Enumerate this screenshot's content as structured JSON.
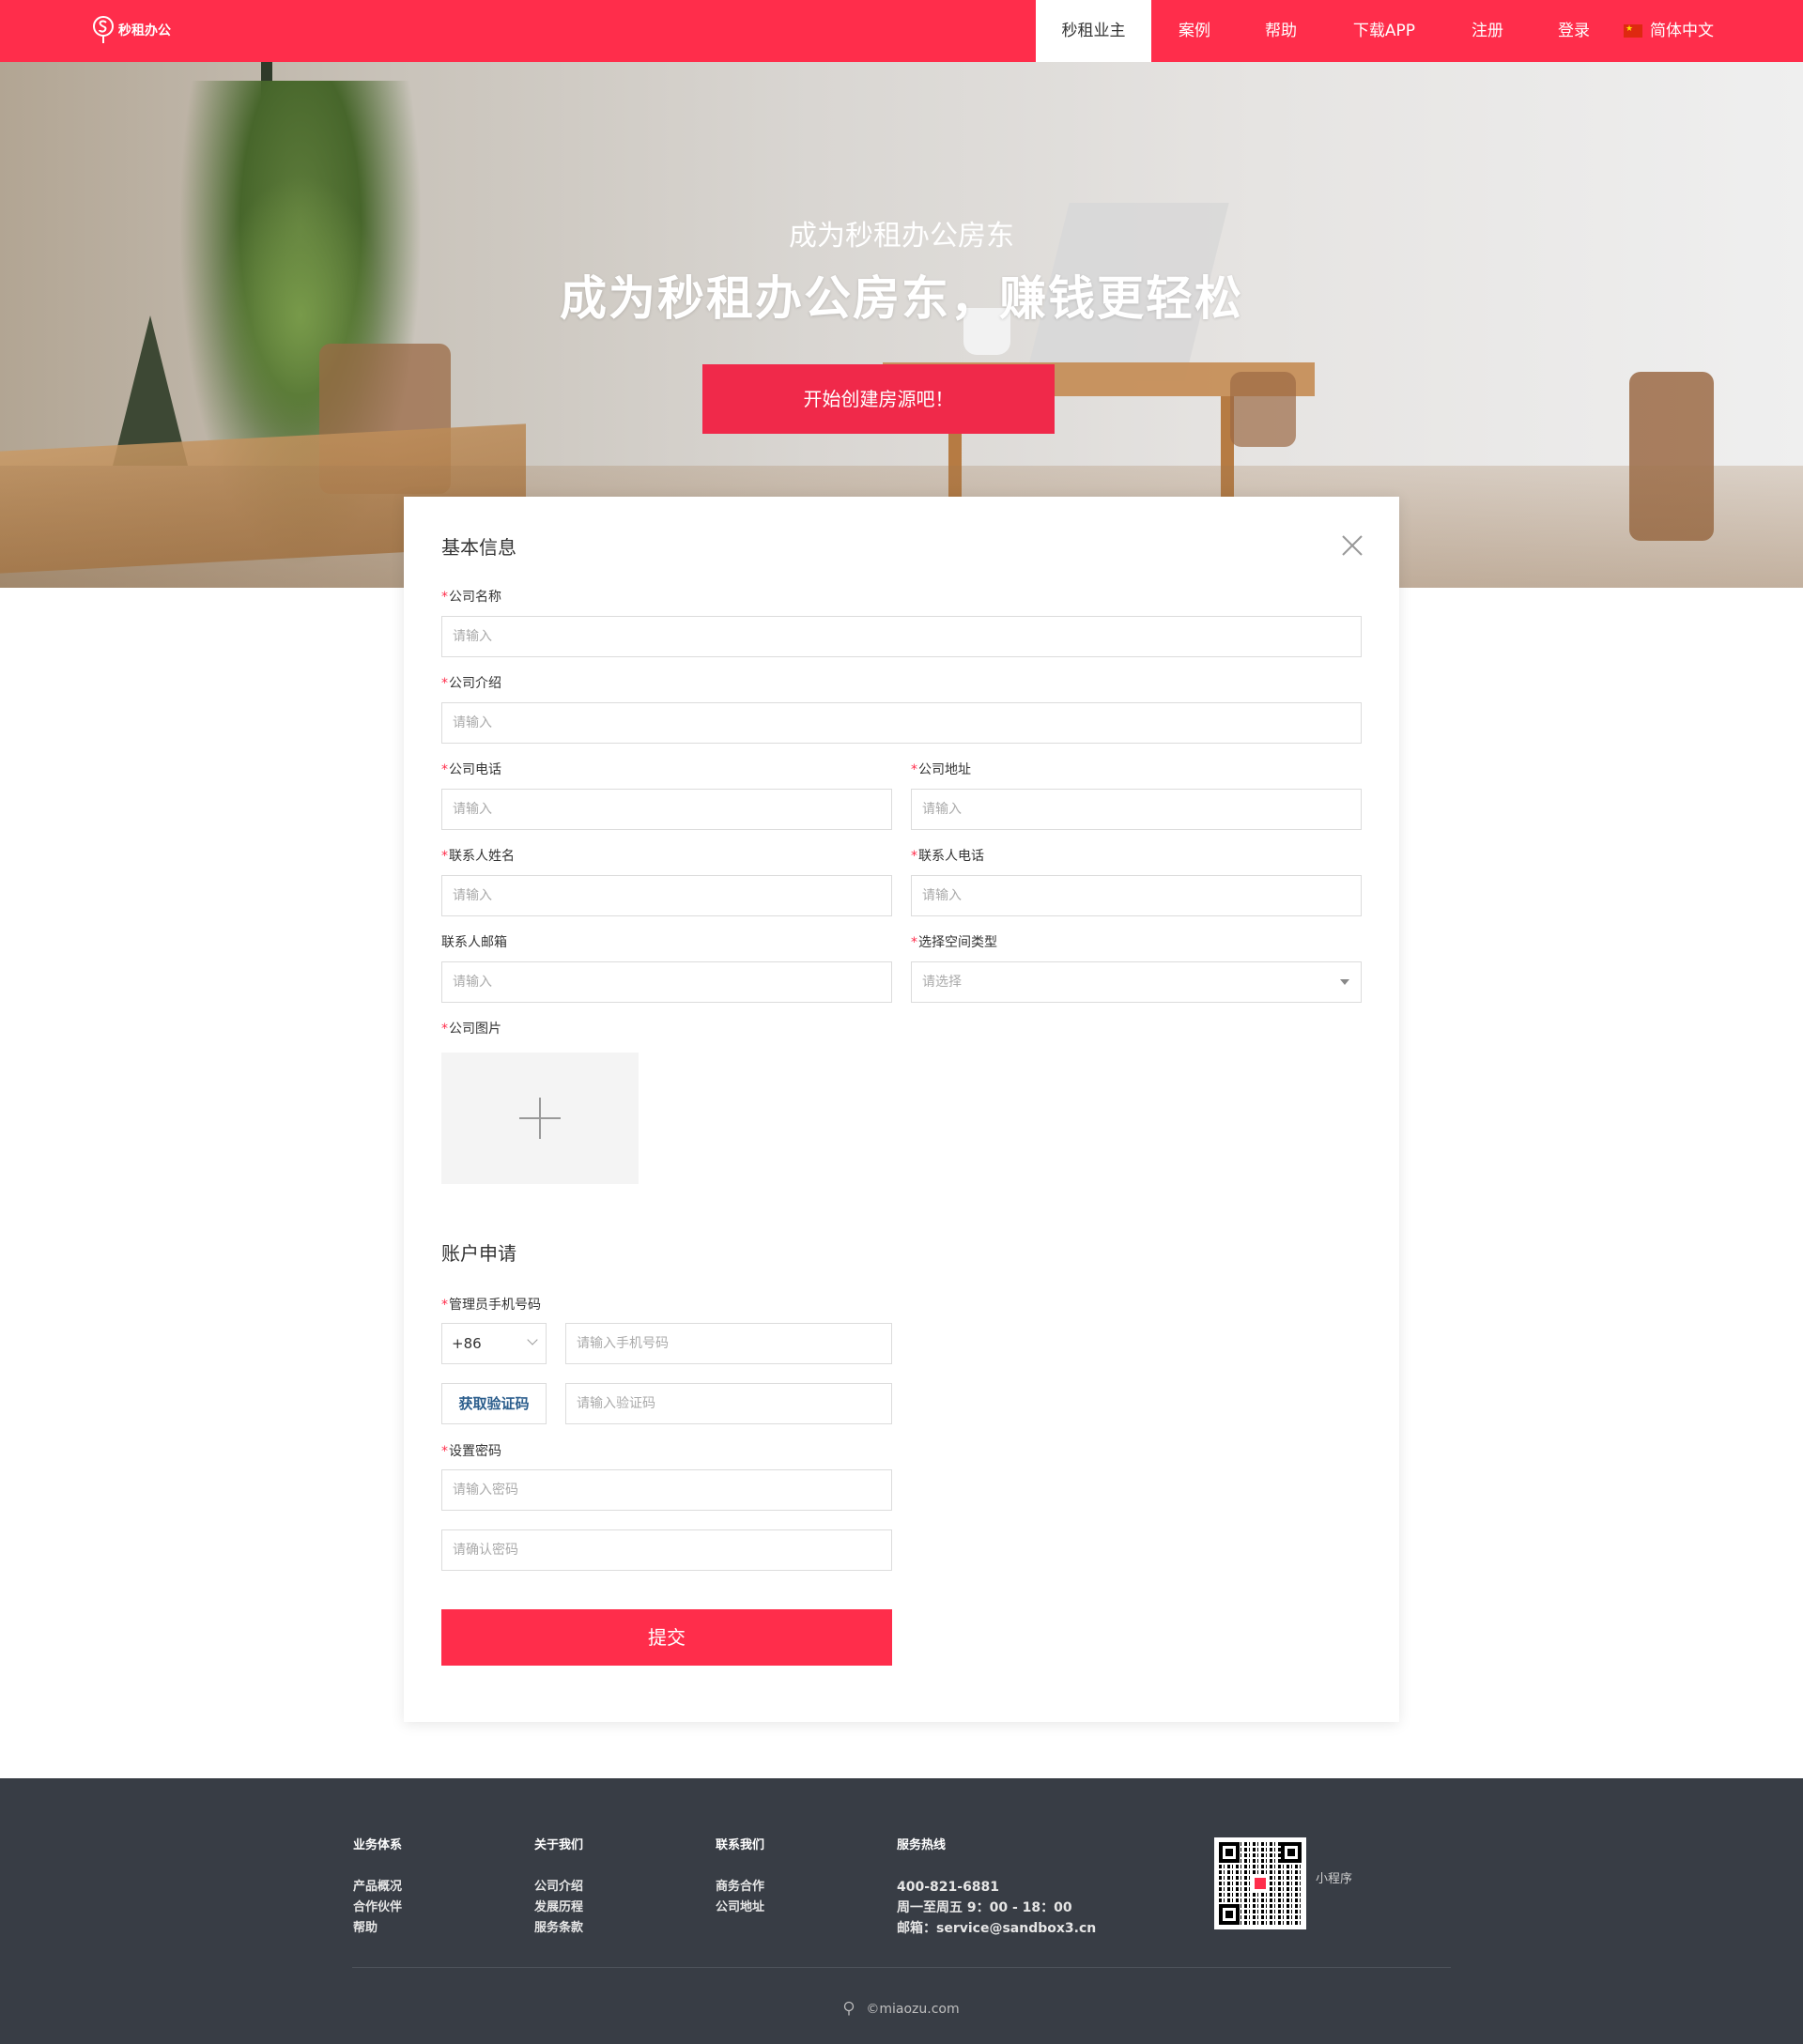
{
  "nav": {
    "logo_text": "秒租办公",
    "items": [
      {
        "label": "秒租业主",
        "active": true
      },
      {
        "label": "案例"
      },
      {
        "label": "帮助"
      },
      {
        "label": "下载APP"
      },
      {
        "label": "注册"
      },
      {
        "label": "登录"
      }
    ],
    "language": "简体中文",
    "brand_color": "#ff2d4b"
  },
  "hero": {
    "subtitle": "成为秒租办公房东",
    "title": "成为秒租办公房东，赚钱更轻松",
    "cta": "开始创建房源吧！"
  },
  "form": {
    "basic_title": "基本信息",
    "required_mark": "*",
    "fields": {
      "company_name": {
        "label": "公司名称",
        "placeholder": "请输入"
      },
      "company_intro": {
        "label": "公司介绍",
        "placeholder": "请输入"
      },
      "company_phone": {
        "label": "公司电话",
        "placeholder": "请输入"
      },
      "company_address": {
        "label": "公司地址",
        "placeholder": "请输入"
      },
      "contact_name": {
        "label": "联系人姓名",
        "placeholder": "请输入"
      },
      "contact_phone": {
        "label": "联系人电话",
        "placeholder": "请输入"
      },
      "contact_email": {
        "label": "联系人邮箱",
        "placeholder": "请输入"
      },
      "space_type": {
        "label": "选择空间类型",
        "placeholder": "请选择"
      },
      "company_images": {
        "label": "公司图片"
      }
    },
    "account_title": "账户申请",
    "account": {
      "phone_label": "管理员手机号码",
      "country_code": "+86",
      "phone_placeholder": "请输入手机号码",
      "get_code": "获取验证码",
      "code_placeholder": "请输入验证码",
      "password_label": "设置密码",
      "password_placeholder": "请输入密码",
      "confirm_placeholder": "请确认密码"
    },
    "submit": "提交"
  },
  "footer": {
    "columns": [
      {
        "title": "业务体系",
        "links": [
          "产品概况",
          "合作伙伴",
          "帮助"
        ]
      },
      {
        "title": "关于我们",
        "links": [
          "公司介绍",
          "发展历程",
          "服务条款"
        ]
      },
      {
        "title": "联系我们",
        "links": [
          "商务合作",
          "公司地址"
        ]
      }
    ],
    "hotline": {
      "title": "服务热线",
      "phone": "400-821-6881",
      "hours": "周一至周五 9：00 - 18：00",
      "email": "邮箱：service@sandbox3.cn"
    },
    "qr_label": "小程序",
    "copyright": "©miaozu.com"
  }
}
